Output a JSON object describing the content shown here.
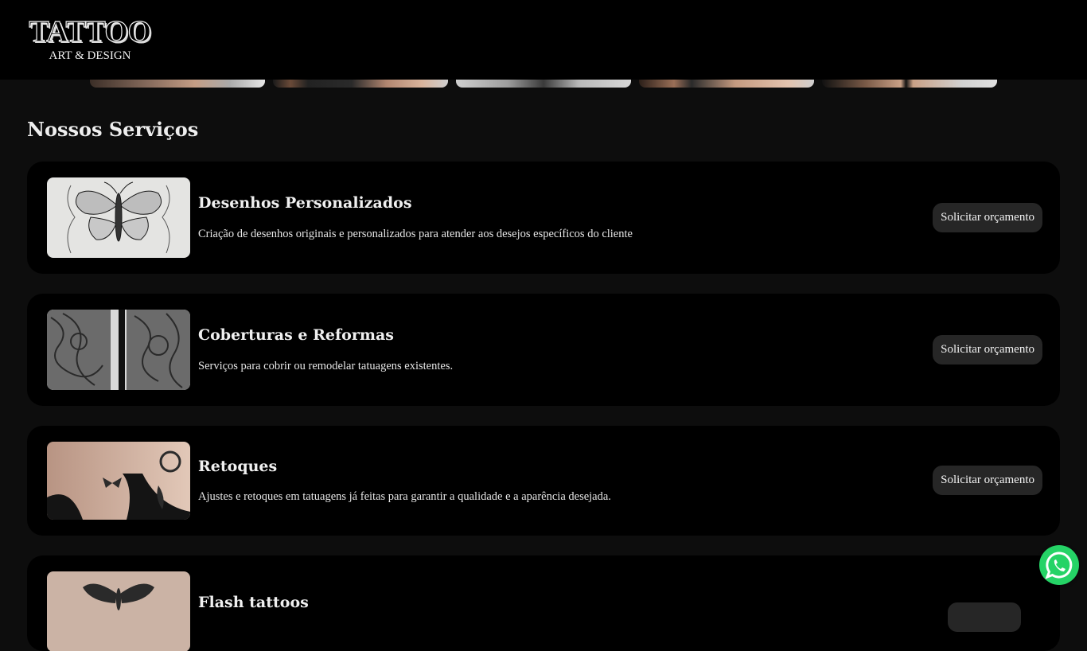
{
  "header": {
    "logo_title": "TATTOO",
    "logo_subtitle": "ART & DESIGN"
  },
  "gallery": {
    "thumbnails": [
      "tattoo-photo",
      "tattoo-photo",
      "tattoo-sketch",
      "tattoo-photo",
      "tattoo-photo"
    ]
  },
  "services": {
    "title": "Nossos Serviços",
    "items": [
      {
        "title": "Desenhos Personalizados",
        "description": "Criação de desenhos originais e personalizados para atender aos desejos específicos do cliente",
        "button": "Solicitar orçamento",
        "image": "butterfly-sketch"
      },
      {
        "title": "Coberturas e Reformas",
        "description": "Serviços para cobrir ou remodelar tatuagens existentes.",
        "button": "Solicitar orçamento",
        "image": "sleeve-tattoo"
      },
      {
        "title": "Retoques",
        "description": "Ajustes e retoques em tatuagens já feitas para garantir a qualidade e a aparência desejada.",
        "button": "Solicitar orçamento",
        "image": "shoulder-tattoo"
      },
      {
        "title": "Flash tattoos",
        "description": "",
        "button": "",
        "image": "moth-tattoo"
      }
    ]
  },
  "floating": {
    "whatsapp_icon": "whatsapp-icon",
    "whatsapp_color": "#25d366"
  },
  "colors": {
    "page_bg": "#0d0d0d",
    "card_bg": "#000000",
    "button_bg": "#262626"
  }
}
